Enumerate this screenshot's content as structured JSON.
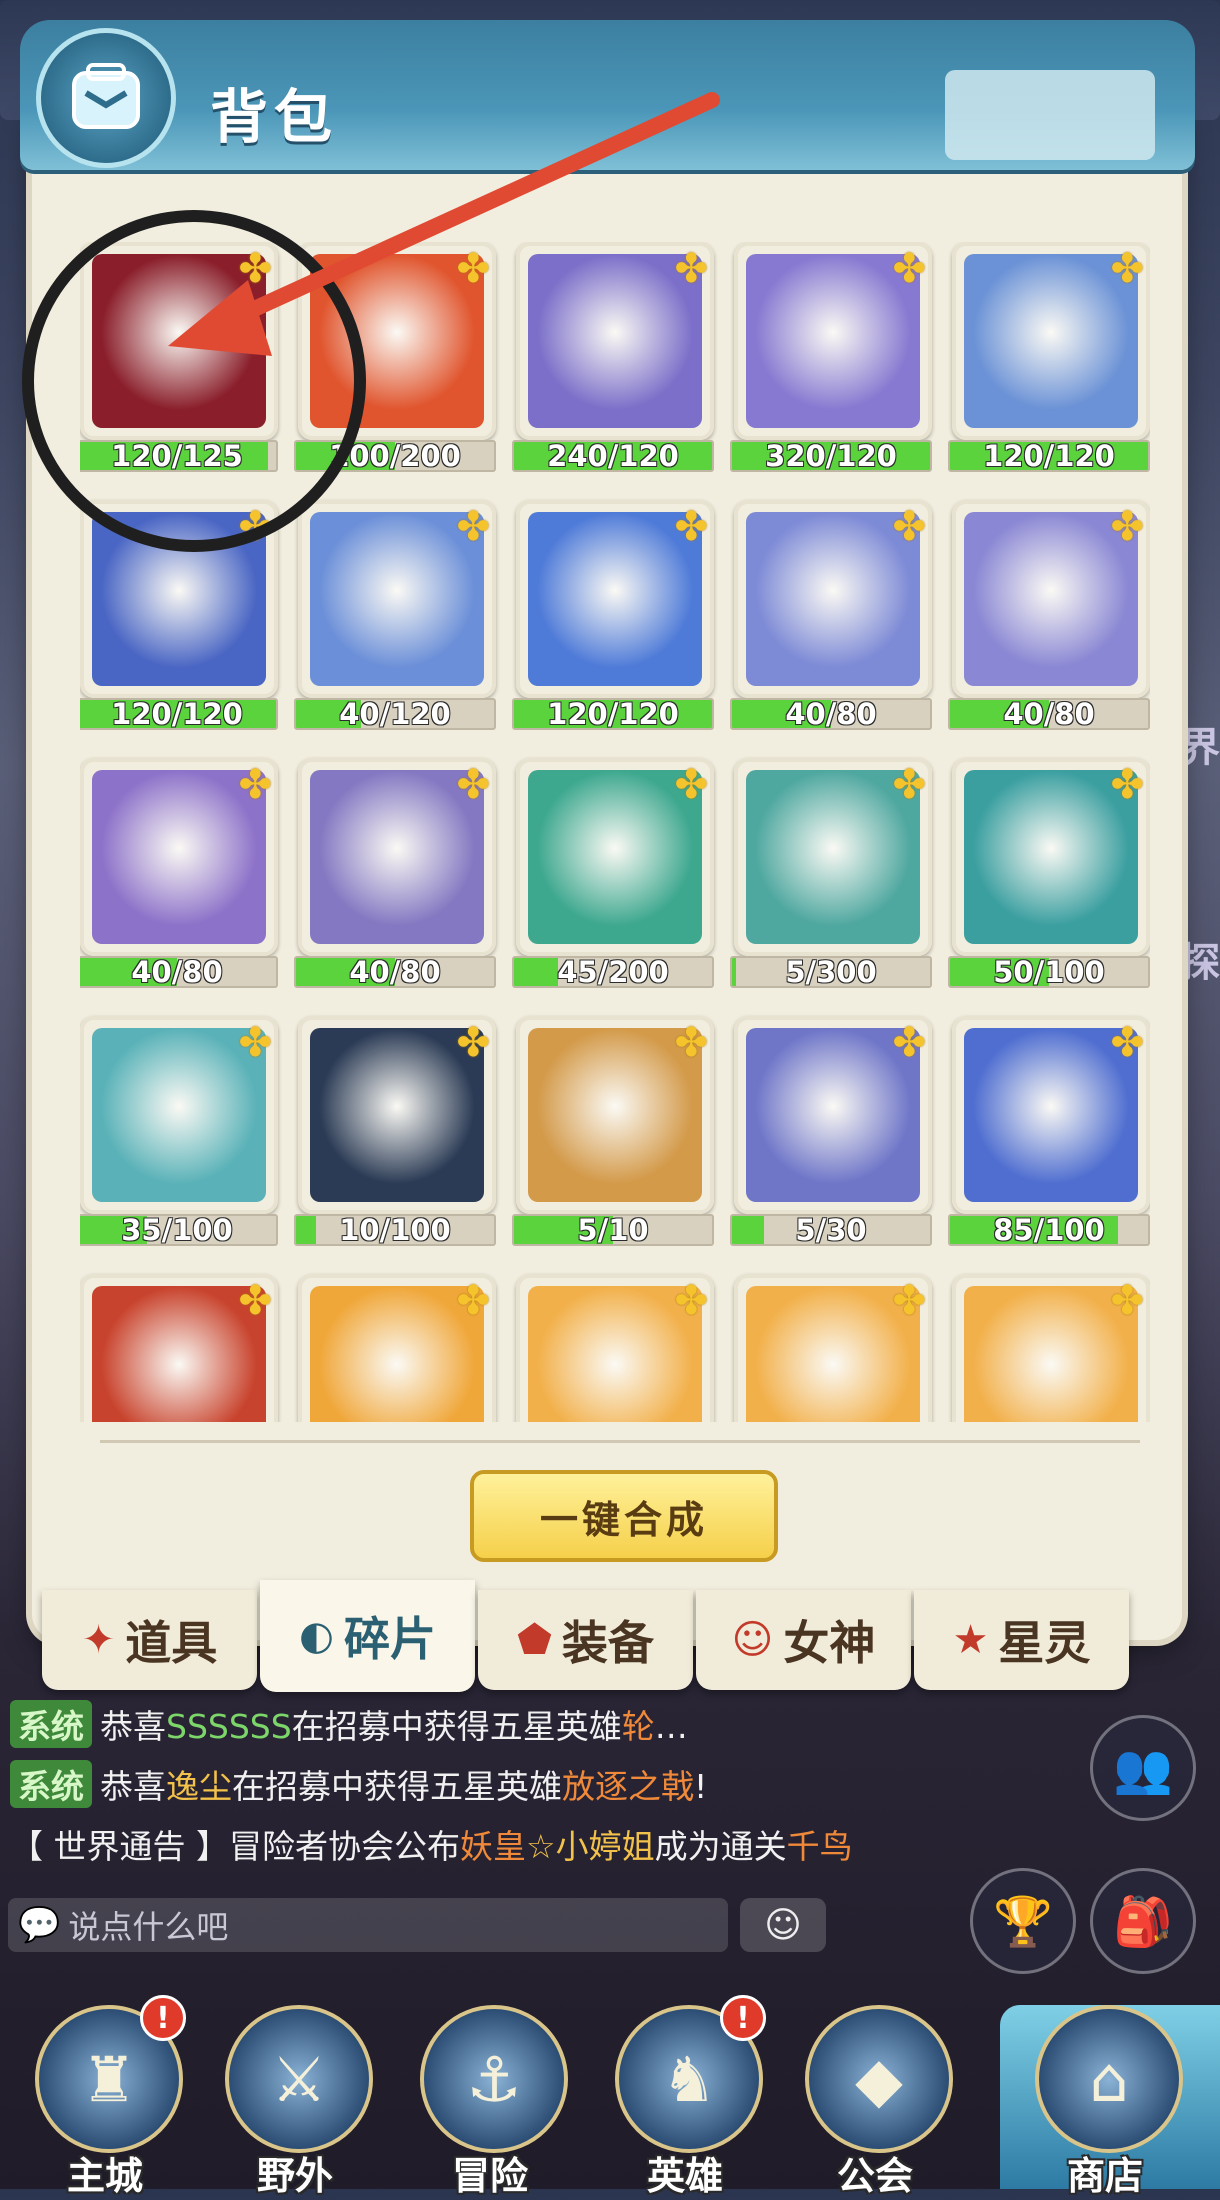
{
  "header": {
    "title": "背包",
    "bag_icon": "backpack-icon"
  },
  "grid": {
    "items": [
      {
        "progress": "120/125",
        "pct": 96,
        "bg": "#8a1f2b"
      },
      {
        "progress": "100/200",
        "pct": 50,
        "bg": "#e0552e"
      },
      {
        "progress": "240/120",
        "pct": 100,
        "bg": "#7b6fc9"
      },
      {
        "progress": "320/120",
        "pct": 100,
        "bg": "#8779d1"
      },
      {
        "progress": "120/120",
        "pct": 100,
        "bg": "#6b92d6"
      },
      {
        "progress": "120/120",
        "pct": 100,
        "bg": "#4a66c4"
      },
      {
        "progress": "40/120",
        "pct": 33,
        "bg": "#6b8fd8"
      },
      {
        "progress": "120/120",
        "pct": 100,
        "bg": "#4f7bd8"
      },
      {
        "progress": "40/80",
        "pct": 50,
        "bg": "#7d8ad6"
      },
      {
        "progress": "40/80",
        "pct": 50,
        "bg": "#8a87d4"
      },
      {
        "progress": "40/80",
        "pct": 50,
        "bg": "#8d72c9"
      },
      {
        "progress": "40/80",
        "pct": 50,
        "bg": "#8478c2"
      },
      {
        "progress": "45/200",
        "pct": 22,
        "bg": "#3ea88f"
      },
      {
        "progress": "5/300",
        "pct": 2,
        "bg": "#4fa8a0"
      },
      {
        "progress": "50/100",
        "pct": 50,
        "bg": "#3b9fa0"
      },
      {
        "progress": "35/100",
        "pct": 35,
        "bg": "#5ab2b8"
      },
      {
        "progress": "10/100",
        "pct": 10,
        "bg": "#2b3b55"
      },
      {
        "progress": "5/10",
        "pct": 50,
        "bg": "#d39a4a"
      },
      {
        "progress": "5/30",
        "pct": 16,
        "bg": "#6f76c8"
      },
      {
        "progress": "85/100",
        "pct": 85,
        "bg": "#4f6ed0"
      },
      {
        "progress": "",
        "pct": 0,
        "bg": "#c8432d"
      },
      {
        "progress": "",
        "pct": 0,
        "bg": "#f0a73a"
      },
      {
        "progress": "",
        "pct": 0,
        "bg": "#f2b04a"
      },
      {
        "progress": "",
        "pct": 0,
        "bg": "#f2b04a"
      },
      {
        "progress": "",
        "pct": 0,
        "bg": "#f2b04a"
      }
    ]
  },
  "merge_button": "一键合成",
  "tabs": [
    {
      "label": "道具",
      "icon": "item-icon",
      "glyph": "✦"
    },
    {
      "label": "碎片",
      "icon": "fragment-icon",
      "glyph": "◐"
    },
    {
      "label": "装备",
      "icon": "equipment-icon",
      "glyph": "⬟"
    },
    {
      "label": "女神",
      "icon": "goddess-icon",
      "glyph": "☺"
    },
    {
      "label": "星灵",
      "icon": "star-spirit-icon",
      "glyph": "★"
    }
  ],
  "active_tab": "碎片",
  "chat": {
    "line1": {
      "badge": "系统",
      "pre": "恭喜",
      "name": "SSSSSS",
      "mid": "在招募中获得五星英雄",
      "item": "轮",
      "post": "…"
    },
    "line2": {
      "badge": "系统",
      "pre": "恭喜",
      "name": "逸尘",
      "mid": "在招募中获得五星英雄",
      "item": "放逐之戟",
      "post": "!"
    },
    "line3": {
      "pre": "【 世界通告 】冒险者协会公布",
      "name1": "妖皇",
      "star": "☆",
      "name2": "小婷姐",
      "mid": "成为通关",
      "item": "千鸟"
    },
    "input_placeholder": "说点什么吧"
  },
  "side_text": {
    "world": "界",
    "explore": "探"
  },
  "nav": [
    {
      "label": "主城",
      "icon": "castle-icon",
      "glyph": "♜",
      "alert": "!"
    },
    {
      "label": "野外",
      "icon": "wild-icon",
      "glyph": "⚔",
      "alert": ""
    },
    {
      "label": "冒险",
      "icon": "adventure-icon",
      "glyph": "⚓",
      "alert": ""
    },
    {
      "label": "英雄",
      "icon": "hero-icon",
      "glyph": "♞",
      "alert": "!"
    },
    {
      "label": "公会",
      "icon": "guild-icon",
      "glyph": "◆",
      "alert": ""
    },
    {
      "label": "商店",
      "icon": "shop-icon",
      "glyph": "⌂",
      "alert": ""
    }
  ],
  "colors": {
    "accent": "#3c7fa0",
    "progress_green": "#5bd33d",
    "annotation_arrow": "#e04a33"
  }
}
